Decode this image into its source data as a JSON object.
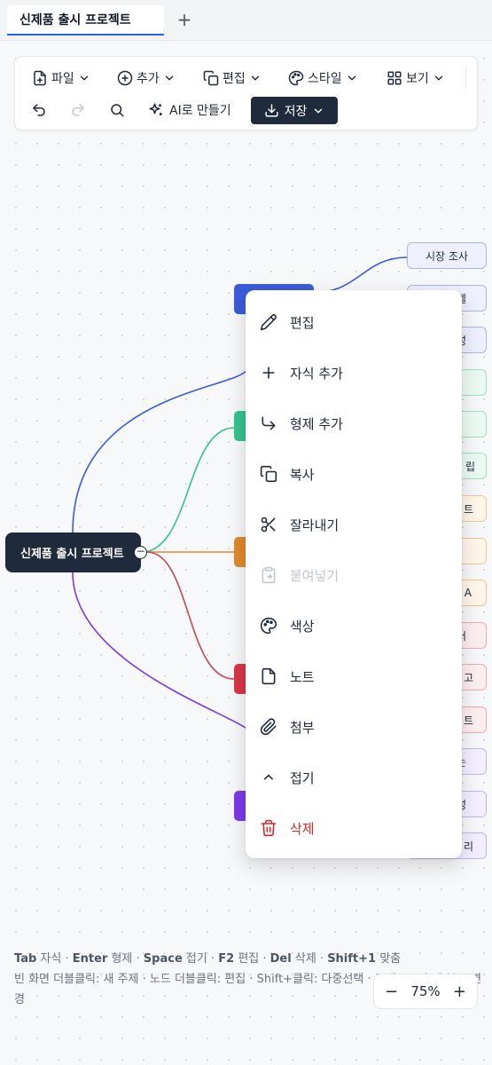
{
  "tabs": [
    {
      "label": "신제품 출시 프로젝트",
      "active": true
    }
  ],
  "toolbar": {
    "file": "파일",
    "add": "추가",
    "edit": "편집",
    "style": "스타일",
    "view": "보기",
    "ai": "AI로 만들기",
    "save": "저장"
  },
  "mindmap": {
    "root": "신제품 출시 프로젝트",
    "branch_colors": [
      "#3b5bdb",
      "#34c38f",
      "#e08a2c",
      "#dc3545",
      "#7c3aed"
    ],
    "leaves": [
      {
        "label": "시장 조사",
        "color": "blue"
      },
      {
        "label": "벨",
        "color": "blue"
      },
      {
        "label": "성",
        "color": "blue"
      },
      {
        "label": "",
        "color": "green"
      },
      {
        "label": "",
        "color": "green"
      },
      {
        "label": "립",
        "color": "green"
      },
      {
        "label": "트",
        "color": "orange"
      },
      {
        "label": "",
        "color": "orange"
      },
      {
        "label": "A",
        "color": "orange"
      },
      {
        "label": "러",
        "color": "red"
      },
      {
        "label": "고",
        "color": "red"
      },
      {
        "label": "트",
        "color": "red"
      },
      {
        "label": "는",
        "color": "purple"
      },
      {
        "label": "성",
        "color": "purple"
      },
      {
        "label": "리",
        "color": "purple"
      }
    ]
  },
  "context_menu": {
    "items": [
      {
        "label": "편집",
        "icon": "pencil-icon",
        "enabled": true
      },
      {
        "label": "자식 추가",
        "icon": "plus-icon",
        "enabled": true
      },
      {
        "label": "형제 추가",
        "icon": "corner-down-right-icon",
        "enabled": true
      },
      {
        "label": "복사",
        "icon": "copy-icon",
        "enabled": true
      },
      {
        "label": "잘라내기",
        "icon": "scissors-icon",
        "enabled": true
      },
      {
        "label": "붙여넣기",
        "icon": "clipboard-icon",
        "enabled": false
      },
      {
        "label": "색상",
        "icon": "palette-icon",
        "enabled": true
      },
      {
        "label": "노트",
        "icon": "note-icon",
        "enabled": true
      },
      {
        "label": "첨부",
        "icon": "paperclip-icon",
        "enabled": true
      },
      {
        "label": "접기",
        "icon": "chevron-up-icon",
        "enabled": true
      },
      {
        "label": "삭제",
        "icon": "trash-icon",
        "enabled": true,
        "danger": true
      }
    ]
  },
  "shortcuts": {
    "line1": [
      {
        "key": "Tab",
        "desc": "자식"
      },
      {
        "key": "Enter",
        "desc": "형제"
      },
      {
        "key": "Space",
        "desc": "접기"
      },
      {
        "key": "F2",
        "desc": "편집"
      },
      {
        "key": "Del",
        "desc": "삭제"
      },
      {
        "key": "Shift+1",
        "desc": "맞춤"
      }
    ],
    "line2": "빈 화면 더블클릭: 새 주제 · 노드 더블클릭: 편집 · Shift+클릭: 다중선택 · 드래그로 순서/부모 변경"
  },
  "zoom": {
    "minus": "−",
    "value": "75%",
    "plus": "+"
  }
}
